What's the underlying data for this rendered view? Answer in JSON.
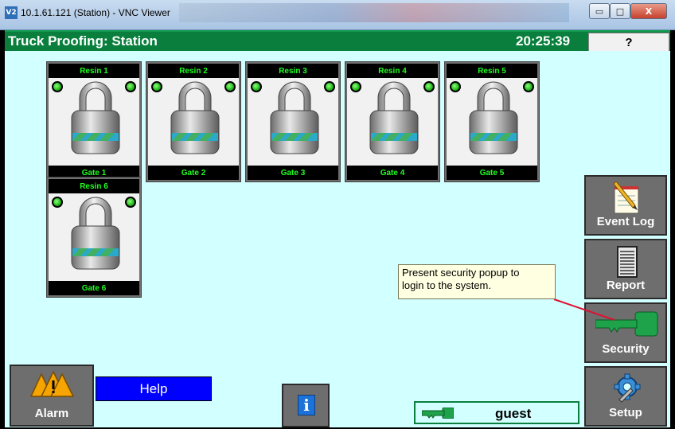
{
  "window": {
    "logo": "V2",
    "title": "10.1.61.121 (Station) - VNC Viewer",
    "minimize_glyph": "▭",
    "maximize_glyph": "□",
    "close_glyph": "X"
  },
  "header": {
    "title": "Truck Proofing: Station",
    "time": "20:25:39",
    "help_label": "?"
  },
  "gates": [
    {
      "top_label": "Resin 1",
      "bottom_label": "Gate 1",
      "locked": true,
      "leds": [
        "green",
        "green"
      ]
    },
    {
      "top_label": "Resin 2",
      "bottom_label": "Gate 2",
      "locked": true,
      "leds": [
        "green",
        "green"
      ]
    },
    {
      "top_label": "Resin 3",
      "bottom_label": "Gate 3",
      "locked": true,
      "leds": [
        "green",
        "green"
      ]
    },
    {
      "top_label": "Resin 4",
      "bottom_label": "Gate 4",
      "locked": true,
      "leds": [
        "green",
        "green"
      ]
    },
    {
      "top_label": "Resin 5",
      "bottom_label": "Gate 5",
      "locked": true,
      "leds": [
        "green",
        "green"
      ]
    },
    {
      "top_label": "Resin 6",
      "bottom_label": "Gate 6",
      "locked": true,
      "leds": [
        "green",
        "green"
      ]
    }
  ],
  "sidebar": {
    "event_log": {
      "label": "Event Log",
      "icon": "notepad-icon"
    },
    "report": {
      "label": "Report",
      "icon": "report-icon"
    },
    "security": {
      "label": "Security",
      "icon": "key-icon"
    },
    "setup": {
      "label": "Setup",
      "icon": "gear-wrench-icon"
    }
  },
  "tooltip": {
    "line1": "Present security popup to",
    "line2": "login to the system."
  },
  "footer": {
    "alarm_label": "Alarm",
    "help_label": "Help",
    "info_glyph": "i",
    "user": "guest"
  },
  "colors": {
    "header_green": "#0a7f3d",
    "background": "#d2ffff",
    "led_green": "#1fb71a",
    "label_green": "#20ff20",
    "help_blue": "#0000ff"
  }
}
